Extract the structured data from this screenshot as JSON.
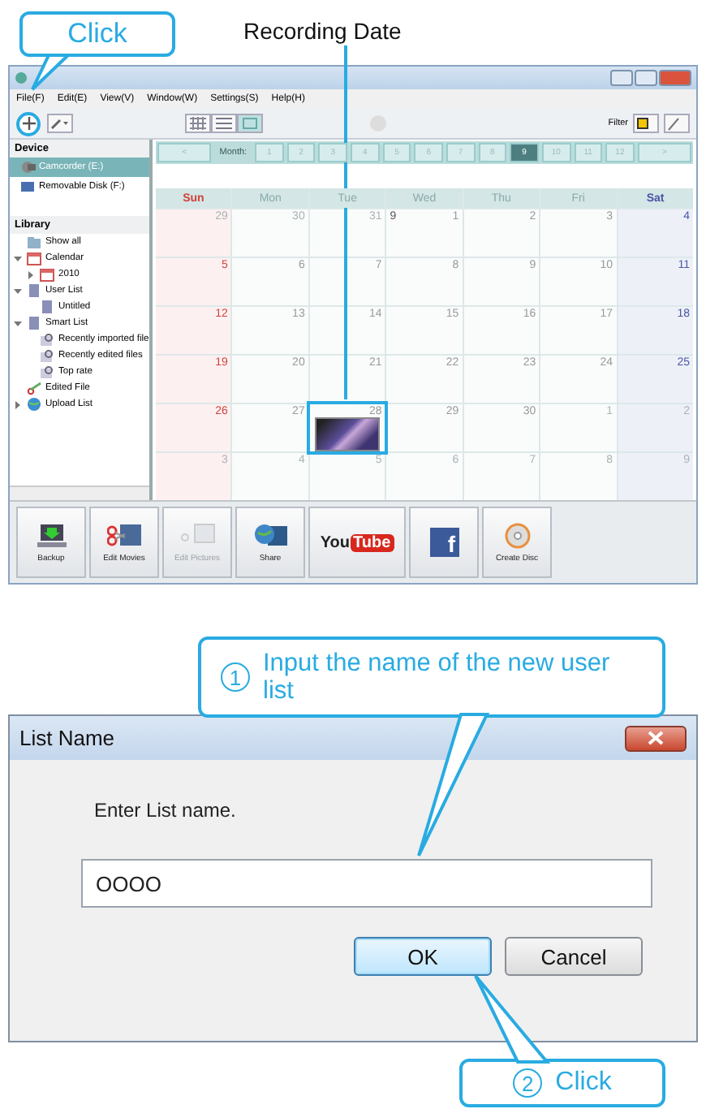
{
  "top_callout": {
    "text": "Click"
  },
  "recording_label": {
    "text": "Recording Date"
  },
  "app": {
    "menu": [
      "File(F)",
      "Edit(E)",
      "View(V)",
      "Window(W)",
      "Settings(S)",
      "Help(H)"
    ],
    "view_modes": [
      {
        "kind": "thumbs",
        "selected": false
      },
      {
        "kind": "list",
        "selected": false
      },
      {
        "kind": "calendar",
        "selected": true
      }
    ],
    "filter_label": "Filter",
    "sidebar": {
      "device_heading": "Device",
      "devices": [
        {
          "label": "Camcorder (E:)",
          "kind": "camera",
          "selected": true
        },
        {
          "label": "Removable Disk (F:)",
          "kind": "disk",
          "selected": false
        }
      ],
      "library_heading": "Library",
      "tree": [
        {
          "label": "Show all",
          "kind": "folder"
        },
        {
          "label": "Calendar",
          "kind": "calendar",
          "expanded": true,
          "children": [
            {
              "label": "2010",
              "kind": "calendar",
              "expanded": false
            }
          ]
        },
        {
          "label": "User List",
          "kind": "list",
          "expanded": true,
          "children": [
            {
              "label": "Untitled",
              "kind": "list"
            }
          ]
        },
        {
          "label": "Smart List",
          "kind": "list",
          "expanded": true,
          "children": [
            {
              "label": "Recently imported file",
              "kind": "search"
            },
            {
              "label": "Recently edited files",
              "kind": "search"
            },
            {
              "label": "Top rate",
              "kind": "search"
            }
          ]
        },
        {
          "label": "Edited File",
          "kind": "scissors"
        },
        {
          "label": "Upload List",
          "kind": "globe",
          "expanded": false
        }
      ]
    },
    "calendar": {
      "prev": "<",
      "next": ">",
      "month_label": "Month:",
      "months": [
        {
          "label": "1",
          "selected": false
        },
        {
          "label": "2",
          "selected": false
        },
        {
          "label": "3",
          "selected": false
        },
        {
          "label": "4",
          "selected": false
        },
        {
          "label": "5",
          "selected": false
        },
        {
          "label": "6",
          "selected": false
        },
        {
          "label": "7",
          "selected": false
        },
        {
          "label": "8",
          "selected": false
        },
        {
          "label": "9",
          "selected": true
        },
        {
          "label": "10",
          "selected": false
        },
        {
          "label": "11",
          "selected": false
        },
        {
          "label": "12",
          "selected": false
        }
      ],
      "days": [
        "Sun",
        "Mon",
        "Tue",
        "Wed",
        "Thu",
        "Fri",
        "Sat"
      ],
      "weeks": [
        [
          {
            "day": "29",
            "outside": true
          },
          {
            "day": "30",
            "outside": true
          },
          {
            "day": "31",
            "outside": true
          },
          {
            "day": "1",
            "outside": false,
            "month_mark": "9"
          },
          {
            "day": "2",
            "outside": false
          },
          {
            "day": "3",
            "outside": false
          },
          {
            "day": "4",
            "outside": false
          }
        ],
        [
          {
            "day": "5",
            "outside": false
          },
          {
            "day": "6",
            "outside": false
          },
          {
            "day": "7",
            "outside": false
          },
          {
            "day": "8",
            "outside": false
          },
          {
            "day": "9",
            "outside": false
          },
          {
            "day": "10",
            "outside": false
          },
          {
            "day": "11",
            "outside": false
          }
        ],
        [
          {
            "day": "12",
            "outside": false
          },
          {
            "day": "13",
            "outside": false
          },
          {
            "day": "14",
            "outside": false
          },
          {
            "day": "15",
            "outside": false
          },
          {
            "day": "16",
            "outside": false
          },
          {
            "day": "17",
            "outside": false
          },
          {
            "day": "18",
            "outside": false
          }
        ],
        [
          {
            "day": "19",
            "outside": false
          },
          {
            "day": "20",
            "outside": false
          },
          {
            "day": "21",
            "outside": false
          },
          {
            "day": "22",
            "outside": false
          },
          {
            "day": "23",
            "outside": false
          },
          {
            "day": "24",
            "outside": false
          },
          {
            "day": "25",
            "outside": false
          }
        ],
        [
          {
            "day": "26",
            "outside": false
          },
          {
            "day": "27",
            "outside": false
          },
          {
            "day": "28",
            "outside": false,
            "highlighted": true,
            "thumbnail": true
          },
          {
            "day": "29",
            "outside": false
          },
          {
            "day": "30",
            "outside": false
          },
          {
            "day": "1",
            "outside": true
          },
          {
            "day": "2",
            "outside": true
          }
        ],
        [
          {
            "day": "3",
            "outside": true
          },
          {
            "day": "4",
            "outside": true
          },
          {
            "day": "5",
            "outside": true
          },
          {
            "day": "6",
            "outside": true
          },
          {
            "day": "7",
            "outside": true
          },
          {
            "day": "8",
            "outside": true
          },
          {
            "day": "9",
            "outside": true
          }
        ]
      ]
    },
    "toolbar": [
      {
        "kind": "backup",
        "label": "Backup",
        "disabled": false
      },
      {
        "kind": "edit-movies",
        "label": "Edit Movies",
        "disabled": false
      },
      {
        "kind": "edit-pictures",
        "label": "Edit Pictures",
        "disabled": true
      },
      {
        "kind": "share",
        "label": "Share",
        "disabled": false
      },
      {
        "kind": "youtube",
        "logo": [
          "You",
          "Tube"
        ],
        "disabled": false
      },
      {
        "kind": "facebook",
        "logo": [
          "f"
        ],
        "disabled": false
      },
      {
        "kind": "disc",
        "label": "Create Disc",
        "disabled": false
      }
    ]
  },
  "callout_1": {
    "number": "1",
    "text": "Input the name of the new user list"
  },
  "dialog": {
    "title": "List Name",
    "prompt": "Enter List name.",
    "value": "OOOO",
    "buttons": [
      {
        "label": "OK",
        "default": true
      },
      {
        "label": "Cancel",
        "default": false
      }
    ]
  },
  "callout_2": {
    "number": "2",
    "text": "Click"
  }
}
